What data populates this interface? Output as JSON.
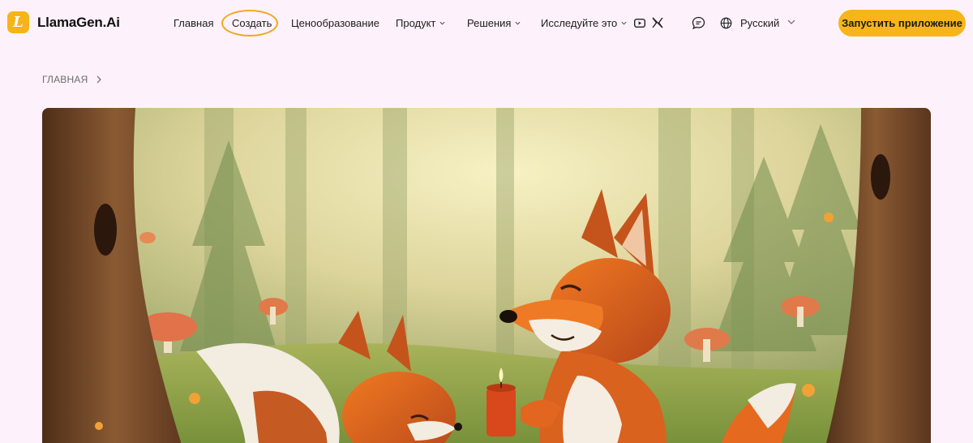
{
  "brand": {
    "name": "LlamaGen.Ai",
    "mark": "L"
  },
  "nav": {
    "home": "Главная",
    "create": "Создать",
    "pricing": "Ценообразование",
    "product": "Продукт",
    "solutions": "Решения",
    "explore": "Исследуйте это",
    "language": "Русский",
    "cta": "Запустить приложение"
  },
  "breadcrumb": {
    "home": "ГЛАВНАЯ"
  },
  "icons": [
    "youtube-icon",
    "x-icon",
    "chat-icon",
    "globe-icon",
    "chevron-down-icon",
    "chevron-right-icon"
  ],
  "colors": {
    "accent": "#f7b51b",
    "background": "#fdf2fc",
    "highlight_ring": "#f0a81c"
  }
}
